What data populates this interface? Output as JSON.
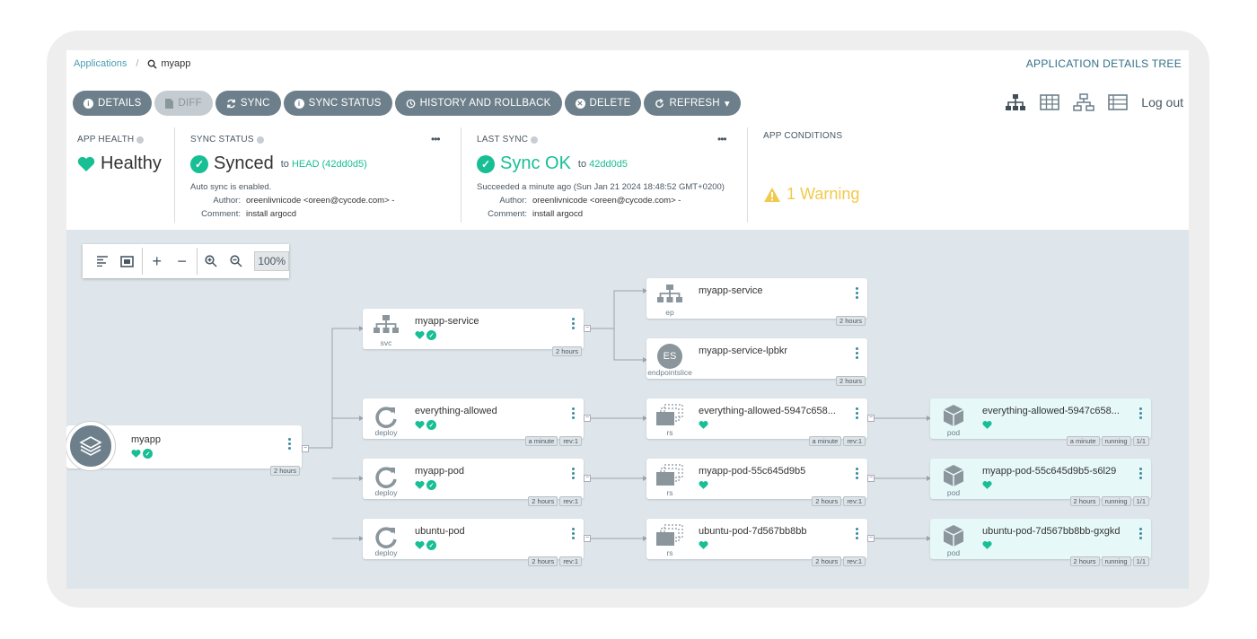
{
  "breadcrumb": {
    "applications": "Applications",
    "separator": "/",
    "current": "myapp"
  },
  "page_title": "APPLICATION DETAILS TREE",
  "toolbar": {
    "details": "DETAILS",
    "diff": "DIFF",
    "sync": "SYNC",
    "sync_status": "SYNC STATUS",
    "history": "HISTORY AND ROLLBACK",
    "delete": "DELETE",
    "refresh": "REFRESH"
  },
  "view_icons": [
    "tree-view-icon",
    "pods-view-icon",
    "network-view-icon",
    "list-view-icon"
  ],
  "logout": "Log out",
  "app_health": {
    "label": "APP HEALTH",
    "value": "Healthy"
  },
  "sync_status": {
    "label": "SYNC STATUS",
    "value": "Synced",
    "to": "to",
    "revision": "HEAD (42dd0d5)",
    "auto": "Auto sync is enabled.",
    "author_label": "Author:",
    "author": "oreenlivnicode <oreen@cycode.com> -",
    "comment_label": "Comment:",
    "comment": "install argocd"
  },
  "last_sync": {
    "label": "LAST SYNC",
    "value": "Sync OK",
    "to": "to",
    "revision": "42dd0d5",
    "succeeded": "Succeeded a minute ago (Sun Jan 21 2024 18:48:52 GMT+0200)",
    "author_label": "Author:",
    "author": "oreenlivnicode <oreen@cycode.com> -",
    "comment_label": "Comment:",
    "comment": "install argocd"
  },
  "app_conditions": {
    "label": "APP CONDITIONS",
    "warning": "1 Warning"
  },
  "zoom": {
    "percent": "100%"
  },
  "tree": {
    "root": {
      "name": "myapp",
      "age": "2 hours"
    },
    "nodes": [
      {
        "id": "svc",
        "name": "myapp-service",
        "kind": "svc",
        "tags": [
          "2 hours"
        ],
        "health": true,
        "sync": true
      },
      {
        "id": "deploy1",
        "name": "everything-allowed",
        "kind": "deploy",
        "tags": [
          "a minute",
          "rev:1"
        ],
        "health": true,
        "sync": true
      },
      {
        "id": "deploy2",
        "name": "myapp-pod",
        "kind": "deploy",
        "tags": [
          "2 hours",
          "rev:1"
        ],
        "health": true,
        "sync": true
      },
      {
        "id": "deploy3",
        "name": "ubuntu-pod",
        "kind": "deploy",
        "tags": [
          "2 hours",
          "rev:1"
        ],
        "health": true,
        "sync": true
      },
      {
        "id": "ep",
        "name": "myapp-service",
        "kind": "ep",
        "tags": [
          "2 hours"
        ],
        "health": false,
        "sync": false
      },
      {
        "id": "es",
        "name": "myapp-service-lpbkr",
        "kind": "endpointslice",
        "tags": [
          "2 hours"
        ],
        "health": false,
        "sync": false
      },
      {
        "id": "rs1",
        "name": "everything-allowed-5947c658...",
        "kind": "rs",
        "tags": [
          "a minute",
          "rev:1"
        ],
        "health": true,
        "sync": false
      },
      {
        "id": "rs2",
        "name": "myapp-pod-55c645d9b5",
        "kind": "rs",
        "tags": [
          "2 hours",
          "rev:1"
        ],
        "health": true,
        "sync": false
      },
      {
        "id": "rs3",
        "name": "ubuntu-pod-7d567bb8bb",
        "kind": "rs",
        "tags": [
          "2 hours",
          "rev:1"
        ],
        "health": true,
        "sync": false
      },
      {
        "id": "pod1",
        "name": "everything-allowed-5947c658...",
        "kind": "pod",
        "tags": [
          "a minute",
          "running",
          "1/1"
        ],
        "health": true,
        "sync": false
      },
      {
        "id": "pod2",
        "name": "myapp-pod-55c645d9b5-s6l29",
        "kind": "pod",
        "tags": [
          "2 hours",
          "running",
          "1/1"
        ],
        "health": true,
        "sync": false
      },
      {
        "id": "pod3",
        "name": "ubuntu-pod-7d567bb8bb-gxgkd",
        "kind": "pod",
        "tags": [
          "2 hours",
          "running",
          "1/1"
        ],
        "health": true,
        "sync": false
      }
    ],
    "es_badge": "ES"
  },
  "colors": {
    "accent": "#18be94",
    "button": "#6d7f8b",
    "warning": "#f2c94c",
    "link": "#4a9eb5"
  }
}
